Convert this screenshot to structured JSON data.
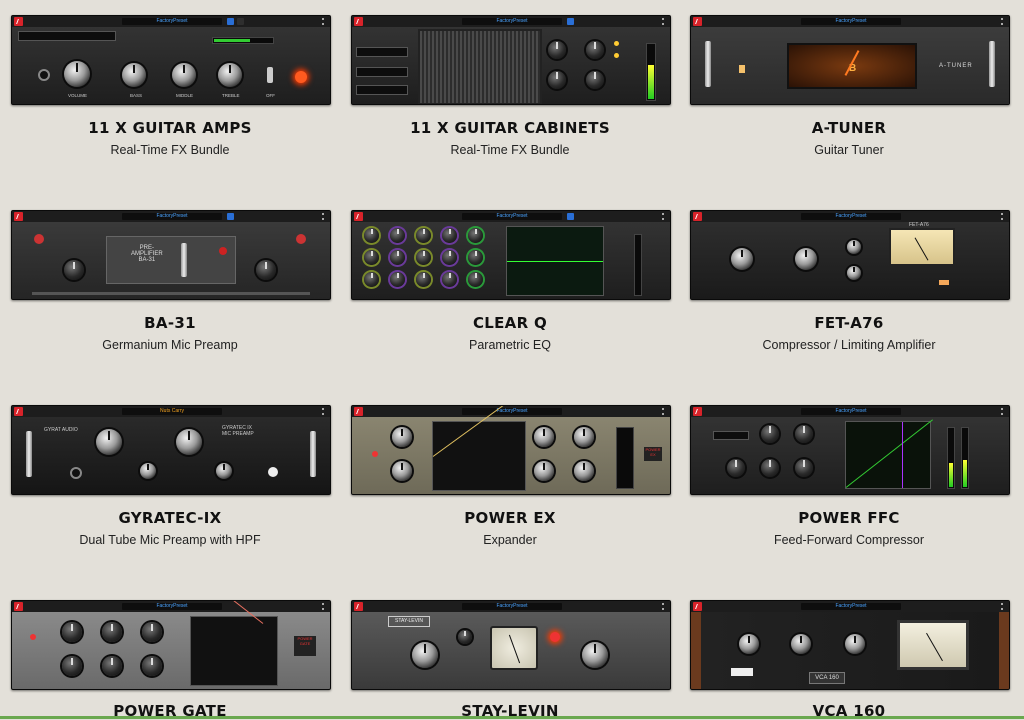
{
  "products": [
    {
      "name": "11 X GUITAR AMPS",
      "desc": "Real-Time FX Bundle",
      "preset": "FactoryPreset"
    },
    {
      "name": "11 X GUITAR CABINETS",
      "desc": "Real-Time FX Bundle",
      "preset": "FactoryPreset"
    },
    {
      "name": "A-TUNER",
      "desc": "Guitar Tuner",
      "preset": "FactoryPreset"
    },
    {
      "name": "BA-31",
      "desc": "Germanium Mic Preamp",
      "preset": "FactoryPreset"
    },
    {
      "name": "CLEAR Q",
      "desc": "Parametric EQ",
      "preset": "FactoryPreset"
    },
    {
      "name": "FET-A76",
      "desc": "Compressor / Limiting Amplifier",
      "preset": "FactoryPreset"
    },
    {
      "name": "GYRATEC-IX",
      "desc": "Dual Tube Mic Preamp with HPF",
      "preset": "Nuts Carry"
    },
    {
      "name": "POWER EX",
      "desc": "Expander",
      "preset": "FactoryPreset"
    },
    {
      "name": "POWER FFC",
      "desc": "Feed-Forward Compressor",
      "preset": "FactoryPreset"
    },
    {
      "name": "POWER GATE",
      "desc": "",
      "preset": "FactoryPreset"
    },
    {
      "name": "STAY-LEVIN",
      "desc": "",
      "preset": "FactoryPreset"
    },
    {
      "name": "VCA 160",
      "desc": "",
      "preset": "FactoryPreset"
    }
  ],
  "plugin_text": {
    "amp_knobs": [
      "VOLUME",
      "BASS",
      "MIDDLE",
      "TREBLE"
    ],
    "amp_switch": "OFF",
    "tuner_note": "B",
    "tuner_brand": "A-TUNER",
    "ba31_label": "PRE-\nAMPLIFIER\nBA-31",
    "fet_label": "FET-A76",
    "gyratec_brand": "GYRAT AUDIO",
    "gyratec_label": "GYRATEC IX\nMIC PREAMP",
    "powerex_badge": "POWER\nEX",
    "powergate_badge": "POWER\nGATE",
    "staylevin_brand": "STAY-LEVIN",
    "vca_badge": "VCA 160"
  },
  "colors": {
    "background": "#e3e0d9",
    "accent_red": "#d8232a",
    "preset_blue": "#4aa3ff",
    "bottom_bar": "#6aa84f"
  }
}
